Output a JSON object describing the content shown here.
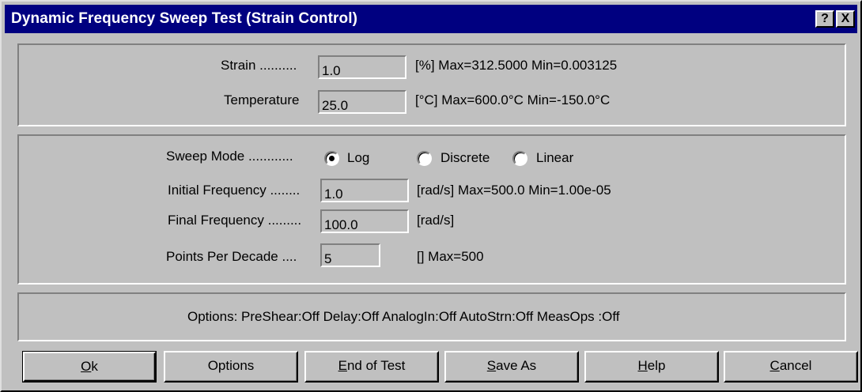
{
  "window": {
    "title": "Dynamic Frequency Sweep Test (Strain Control)",
    "help_label": "?",
    "close_label": "X"
  },
  "strain": {
    "label": "Strain ..........",
    "value": "1.0",
    "info": "[%] Max=312.5000  Min=0.003125"
  },
  "temperature": {
    "label": "Temperature",
    "value": "25.0",
    "info": "[°C] Max=600.0°C  Min=-150.0°C"
  },
  "sweep_mode": {
    "label": "Sweep Mode ............",
    "options": [
      "Log",
      "Discrete",
      "Linear"
    ],
    "selected": "Log"
  },
  "initial_frequency": {
    "label": "Initial Frequency ........",
    "value": "1.0",
    "info": "[rad/s] Max=500.0  Min=1.00e-05"
  },
  "final_frequency": {
    "label": "Final Frequency .........",
    "value": "100.0",
    "info": "[rad/s]"
  },
  "points_per_decade": {
    "label": "Points Per Decade ....",
    "value": "5",
    "info": "[] Max=500"
  },
  "options_line": "Options:  PreShear:Off  Delay:Off  AnalogIn:Off  AutoStrn:Off  MeasOps :Off",
  "buttons": {
    "ok": {
      "acc": "O",
      "rest": "k"
    },
    "options": {
      "label": "Options"
    },
    "end_of_test": {
      "acc": "E",
      "rest": "nd of Test"
    },
    "save_as": {
      "acc": "S",
      "rest": "ave As"
    },
    "help": {
      "acc": "H",
      "rest": "elp"
    },
    "cancel": {
      "acc": "C",
      "rest": "ancel"
    }
  }
}
